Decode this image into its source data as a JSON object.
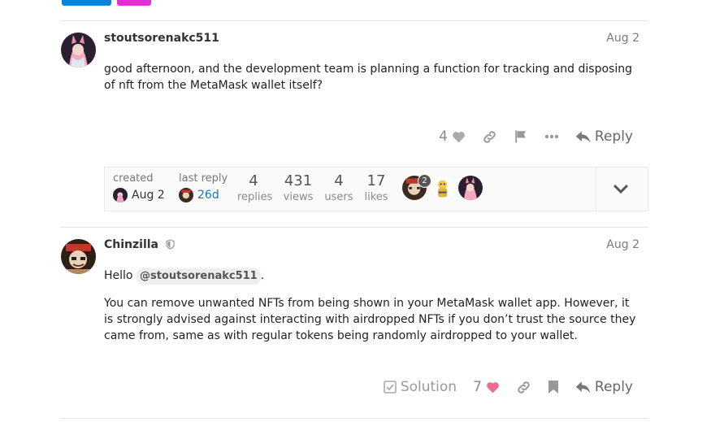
{
  "post1": {
    "username": "stoutsorenakc511",
    "date": "Aug 2",
    "body": "good afternoon, and the development team is planning a function for tracking and disposing of nft from the MetaMask wallet itself?",
    "likes": "4",
    "reply_label": "Reply"
  },
  "topic_map": {
    "created_label": "created",
    "created_date": "Aug 2",
    "last_reply_label": "last reply",
    "last_reply_date": "26d",
    "replies_count": "4",
    "replies_label": "replies",
    "views_count": "431",
    "views_label": "views",
    "users_count": "4",
    "users_label": "users",
    "likes_count": "17",
    "likes_label": "likes",
    "poster_badge": "2"
  },
  "post2": {
    "username": "Chinzilla",
    "date": "Aug 2",
    "greeting": "Hello",
    "mention": "@stoutsorenakc511",
    "greeting_end": ".",
    "body": "You can remove unwanted NFTs from being shown in your MetaMask wallet app. However, it is strongly advised against interacting with airdropped NFTs if you don’t trust the source they came from, same as with regular tokens being randomly airdropped to your wallet.",
    "solution_label": "Solution",
    "likes": "7",
    "reply_label": "Reply"
  },
  "colors": {
    "accent_blue": "#0a84d6",
    "accent_pink": "#e02fd6",
    "heart_pink": "#f06c8f",
    "link_blue": "#1a73c6"
  },
  "icons": [
    "heart-icon",
    "link-icon",
    "flag-icon",
    "more-icon",
    "reply-icon",
    "chevron-down-icon",
    "shield-icon",
    "checkbox-icon",
    "bookmark-icon"
  ]
}
